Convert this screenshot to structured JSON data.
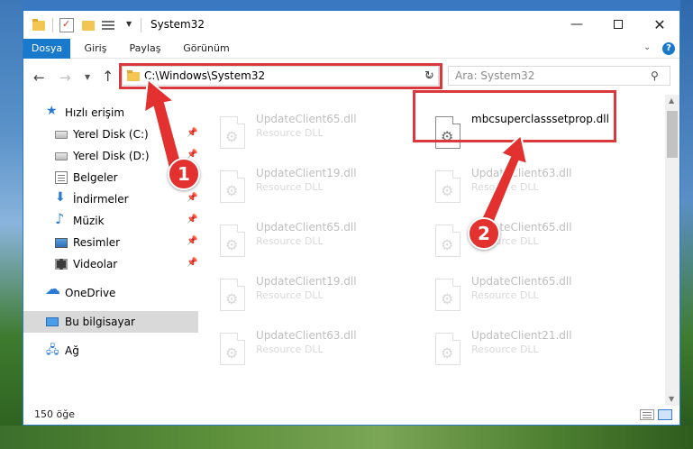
{
  "window": {
    "title": "System32"
  },
  "ribbon": {
    "tabs": [
      "Dosya",
      "Giriş",
      "Paylaş",
      "Görünüm"
    ]
  },
  "nav": {
    "address": "C:\\Windows\\System32",
    "search_placeholder": "Ara: System32"
  },
  "sidebar": {
    "items": [
      {
        "label": "Hızlı erişim",
        "icon": "star-icon"
      },
      {
        "label": "Yerel Disk (C:)",
        "icon": "drive-icon",
        "pinned": true
      },
      {
        "label": "Yerel Disk (D:)",
        "icon": "drive-icon",
        "pinned": true
      },
      {
        "label": "Belgeler",
        "icon": "documents-icon"
      },
      {
        "label": "İndirmeler",
        "icon": "download-icon",
        "pinned": true
      },
      {
        "label": "Müzik",
        "icon": "music-icon",
        "pinned": true
      },
      {
        "label": "Resimler",
        "icon": "pictures-icon",
        "pinned": true
      },
      {
        "label": "Videolar",
        "icon": "video-icon",
        "pinned": true
      },
      {
        "label": "OneDrive",
        "icon": "cloud-icon"
      },
      {
        "label": "Bu bilgisayar",
        "icon": "computer-icon",
        "active": true
      },
      {
        "label": "Ağ",
        "icon": "network-icon"
      }
    ]
  },
  "files": [
    {
      "name": "UpdateClient65.dll",
      "type": "Resource DLL"
    },
    {
      "name": "mbcsuperclasssetprop.dll",
      "type": ""
    },
    {
      "name": "UpdateClient19.dll",
      "type": "Resource DLL"
    },
    {
      "name": "UpdateClient63.dll",
      "type": "Resource DLL"
    },
    {
      "name": "UpdateClient65.dll",
      "type": "Resource DLL"
    },
    {
      "name": "UpdateClient65.dll",
      "type": "Resource DLL"
    },
    {
      "name": "UpdateClient19.dll",
      "type": "Resource DLL"
    },
    {
      "name": "UpdateClient65.dll",
      "type": "Resource DLL"
    },
    {
      "name": "UpdateClient63.dll",
      "type": "Resource DLL"
    },
    {
      "name": "UpdateClient21.dll",
      "type": "Resource DLL"
    }
  ],
  "status": {
    "count": "150 öğe"
  },
  "annotations": {
    "step1": "1",
    "step2": "2",
    "color": "#e2312f"
  }
}
